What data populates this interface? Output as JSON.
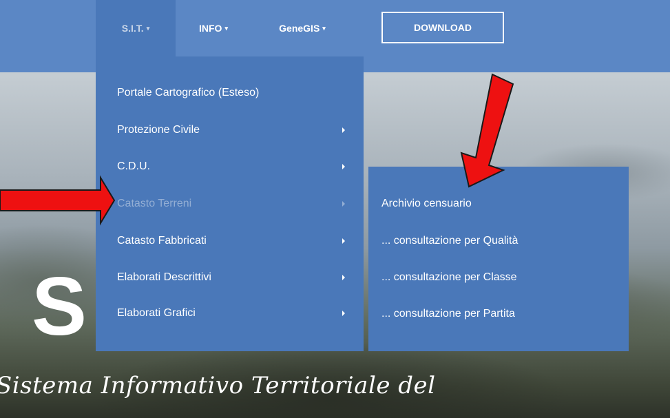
{
  "navbar": {
    "items": [
      {
        "label": "S.I.T.",
        "caret": "▾"
      },
      {
        "label": "INFO",
        "caret": "▾"
      },
      {
        "label": "GeneGIS",
        "caret": "▾"
      }
    ],
    "download_label": "DOWNLOAD"
  },
  "dropdown": {
    "items": [
      {
        "label": "Portale Cartografico (Esteso)"
      },
      {
        "label": "Protezione Civile"
      },
      {
        "label": "C.D.U."
      },
      {
        "label": "Catasto Terreni"
      },
      {
        "label": "Catasto Fabbricati"
      },
      {
        "label": "Elaborati Descrittivi"
      },
      {
        "label": "Elaborati Grafici"
      }
    ]
  },
  "submenu": {
    "items": [
      {
        "label": "Archivio censuario"
      },
      {
        "label": "... consultazione per Qualità"
      },
      {
        "label": "... consultazione per Classe"
      },
      {
        "label": "... consultazione per Partita"
      }
    ]
  },
  "hero": {
    "big_letter": "S",
    "subtitle": "Sistema Informativo Territoriale del"
  },
  "colors": {
    "navbar": "#5b87c5",
    "menu": "#4a78b9",
    "annotation_arrow": "#ee1111"
  }
}
